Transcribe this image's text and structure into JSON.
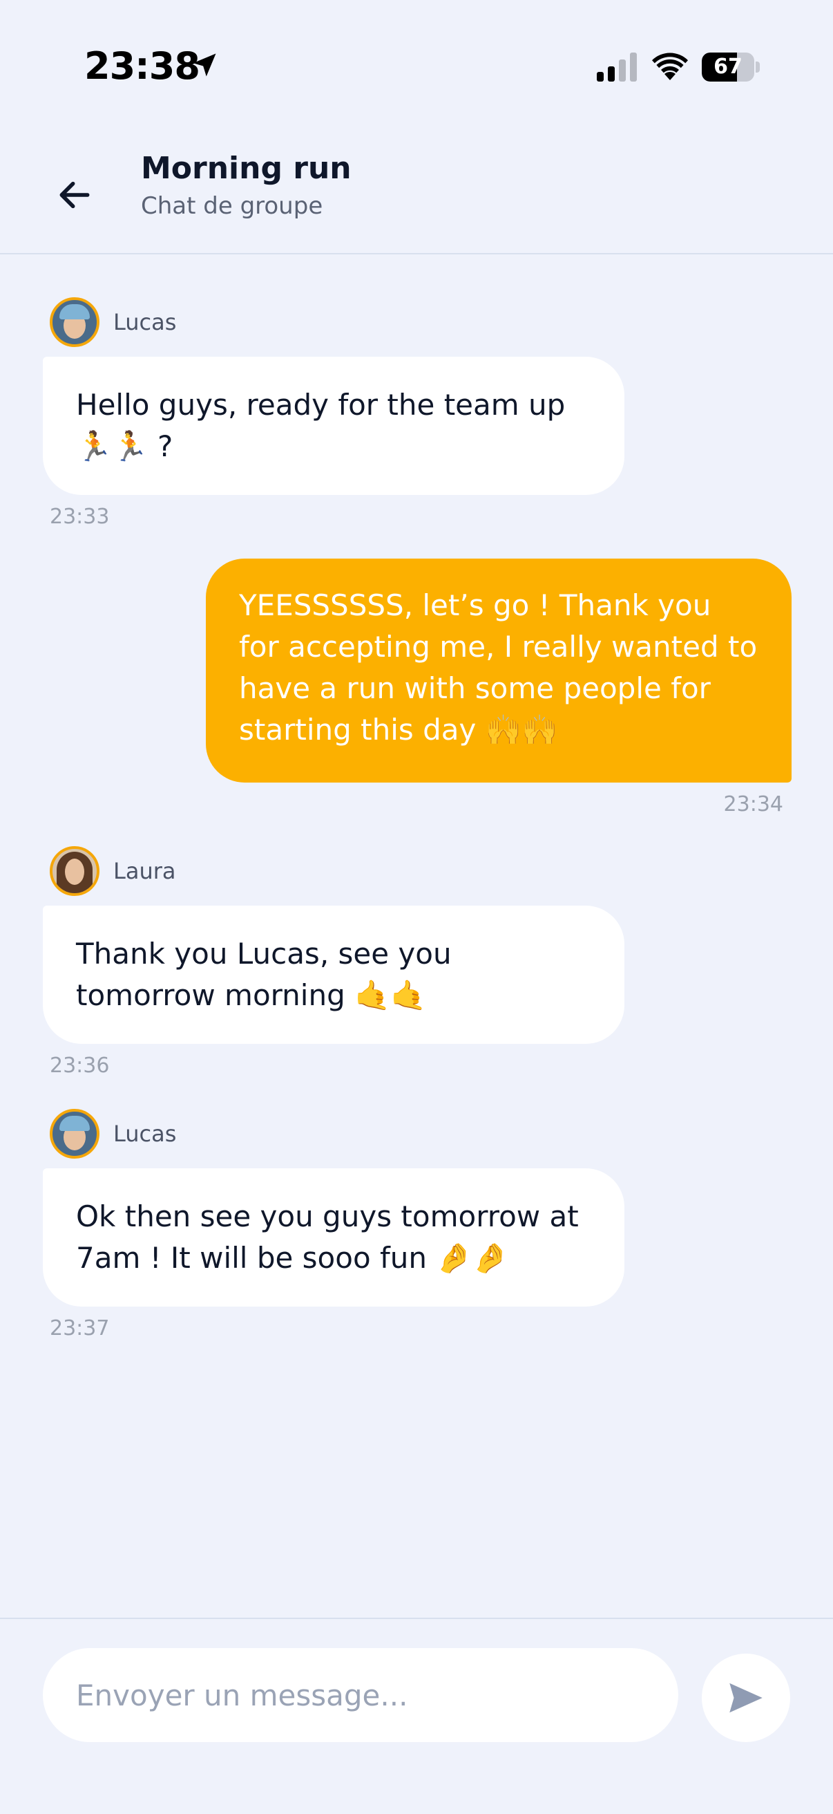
{
  "status_bar": {
    "time": "23:38",
    "battery": "67",
    "battery_level": 0.67,
    "icons": [
      "location-arrow-icon",
      "signal-icon",
      "wifi-icon",
      "battery-icon"
    ]
  },
  "header": {
    "back_icon": "arrow-left-icon",
    "title": "Morning run",
    "subtitle": "Chat de groupe"
  },
  "messages": [
    {
      "sender": "Lucas",
      "direction": "incoming",
      "text": "Hello guys, ready for the team up 🏃🏃 ?",
      "time": "23:33"
    },
    {
      "sender": "",
      "direction": "outgoing",
      "text": "YEESSSSSS, let’s go ! Thank you for accepting me, I really wanted to have a run with some people for starting this day 🙌🙌",
      "time": "23:34"
    },
    {
      "sender": "Laura",
      "direction": "incoming",
      "text": "Thank you Lucas, see you tomorrow morning 🤙🤙",
      "time": "23:36"
    },
    {
      "sender": "Lucas",
      "direction": "incoming",
      "text": "Ok then see you guys tomorrow at 7am ! It will be sooo fun 🤌🤌",
      "time": "23:37"
    }
  ],
  "composer": {
    "placeholder": "Envoyer un message...",
    "value": "",
    "send_icon": "send-icon"
  },
  "colors": {
    "background": "#eff2fb",
    "accent": "#fcb000",
    "incoming_bubble": "#ffffff",
    "text_primary": "#0f172a",
    "text_muted": "#9aa1ae"
  }
}
